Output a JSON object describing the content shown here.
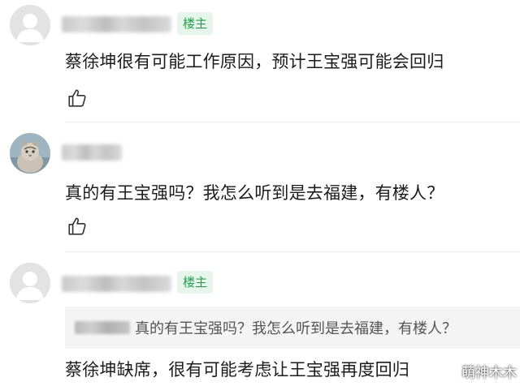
{
  "comments": [
    {
      "badge": "楼主",
      "text": "蔡徐坤很有可能工作原因，预计王宝强可能会回归"
    },
    {
      "text": "真的有王宝强吗？我怎么听到是去福建，有楼人？"
    },
    {
      "badge": "楼主",
      "quote": "真的有王宝强吗？我怎么听到是去福建，有楼人？",
      "text": "蔡徐坤缺席，很有可能考虑让王宝强再度回归"
    }
  ],
  "watermark": "萌神木木",
  "icons": {
    "avatar_default": "user-silhouette-icon",
    "avatar_cat": "cat-photo-avatar",
    "like": "thumbs-up-icon"
  },
  "colors": {
    "badge_bg": "#e6f6ea",
    "badge_text": "#2a9a52",
    "quote_bg": "#f4f4f4"
  }
}
